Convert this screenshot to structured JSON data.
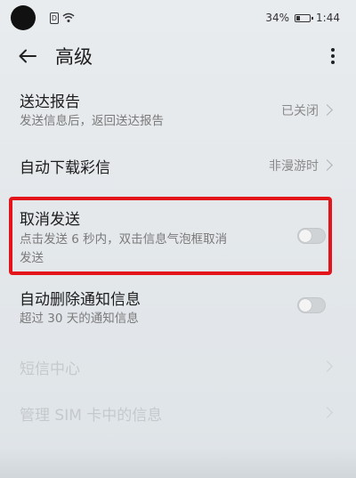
{
  "status_bar": {
    "sim_label": "D",
    "battery_percent": "34%",
    "battery_level": 0.34,
    "time": "1:44"
  },
  "app_bar": {
    "title": "高级"
  },
  "settings": [
    {
      "title": "送达报告",
      "subtitle": "发送信息后，返回送达报告",
      "value": "已关闭",
      "control": "chevron"
    },
    {
      "title": "自动下载彩信",
      "value": "非漫游时",
      "control": "chevron"
    },
    {
      "title": "取消发送",
      "subtitle_line1": "点击发送 6 秒内，双击信息气泡框取消",
      "subtitle_line2": "发送",
      "control": "toggle",
      "enabled": false,
      "highlighted": true
    },
    {
      "title": "自动删除通知信息",
      "subtitle": "超过 30 天的通知信息",
      "control": "toggle",
      "enabled": false
    },
    {
      "title": "短信中心",
      "control": "chevron",
      "disabled": true
    },
    {
      "title": "管理 SIM 卡中的信息",
      "control": "chevron",
      "disabled": true
    }
  ],
  "colors": {
    "highlight": "#e4141b",
    "background": "#e6eaed"
  }
}
